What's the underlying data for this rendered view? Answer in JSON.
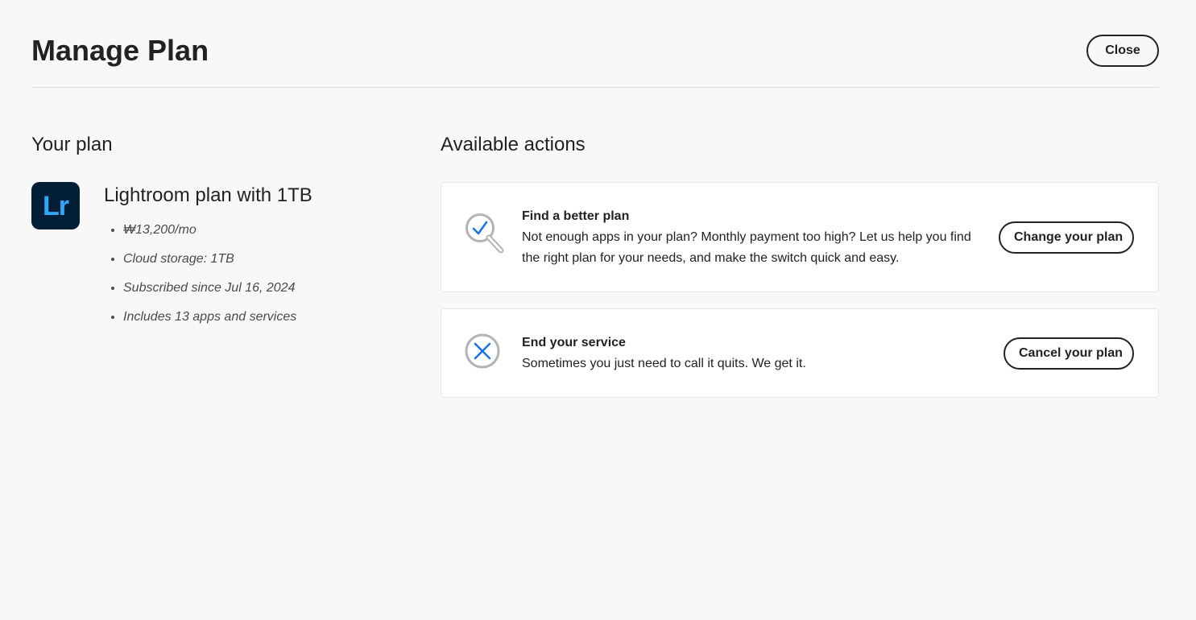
{
  "header": {
    "title": "Manage Plan",
    "close_label": "Close"
  },
  "your_plan": {
    "heading": "Your plan",
    "app_icon_text": "Lr",
    "plan_name": "Lightroom plan with 1TB",
    "details": [
      "₩13,200/mo",
      "Cloud storage: 1TB",
      "Subscribed since Jul 16, 2024",
      "Includes 13 apps and services"
    ]
  },
  "available_actions": {
    "heading": "Available actions",
    "cards": [
      {
        "icon": "magnifier-check-icon",
        "title": "Find a better plan",
        "description": "Not enough apps in your plan? Monthly payment too high? Let us help you find the right plan for your needs, and make the switch quick and easy.",
        "button_label": "Change your plan"
      },
      {
        "icon": "circle-x-icon",
        "title": "End your service",
        "description": "Sometimes you just need to call it quits. We get it.",
        "button_label": "Cancel your plan"
      }
    ]
  },
  "colors": {
    "background": "#f8f8f8",
    "card_background": "#ffffff",
    "text": "#222222",
    "accent_blue": "#1473e6",
    "icon_gray": "#b3b3b3",
    "lightroom_bg": "#001e36",
    "lightroom_text": "#31a8ff"
  }
}
